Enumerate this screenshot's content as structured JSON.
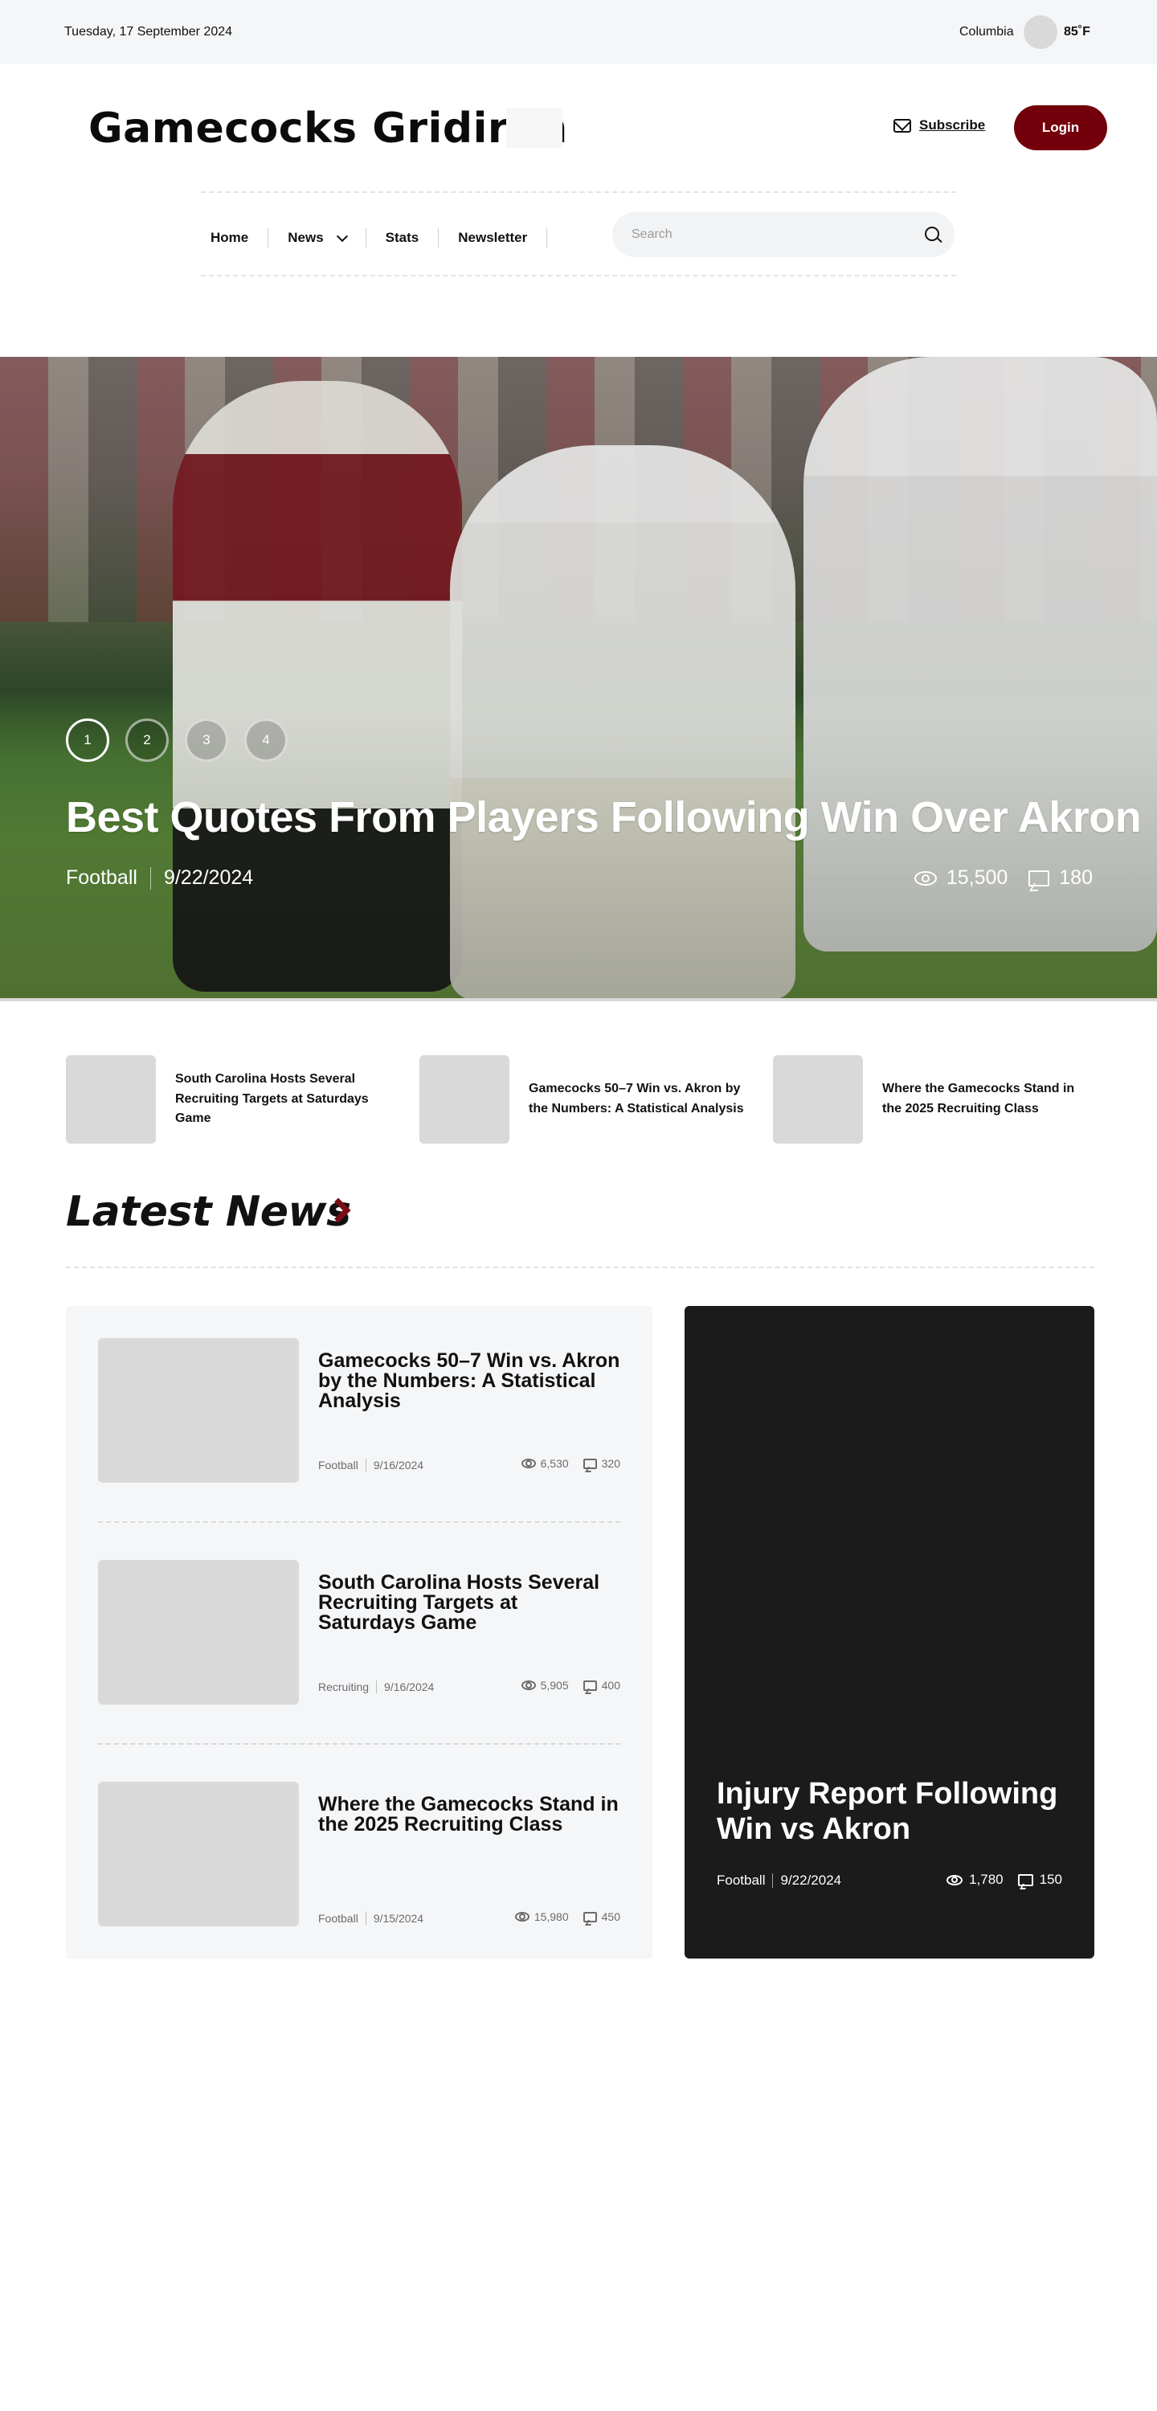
{
  "topbar": {
    "date": "Tuesday, 17 September 2024",
    "location": "Columbia",
    "temperature": "85˚F",
    "weather_icon": "weather-icon"
  },
  "header": {
    "logo": "Gamecocks Gridiron",
    "subscribe_label": "Subscribe",
    "subscribe_icon": "mail-icon",
    "login_label": "Login",
    "accent_color": "#73000a"
  },
  "nav": {
    "items": [
      {
        "label": "Home",
        "has_dropdown": false
      },
      {
        "label": "News",
        "has_dropdown": true
      },
      {
        "label": "Stats",
        "has_dropdown": false
      },
      {
        "label": "Newsletter",
        "has_dropdown": false
      }
    ],
    "search_placeholder": "Search",
    "search_icon": "search-icon"
  },
  "hero": {
    "slides": [
      "1",
      "2",
      "3",
      "4"
    ],
    "active_slide": "1",
    "title": "Best Quotes From Players Following Win Over Akron",
    "category": "Football",
    "date": "9/22/2024",
    "views": "15,500",
    "comments": "180"
  },
  "mini_stories": [
    {
      "title": "South Carolina Hosts Several Recruiting Targets at Saturdays Game"
    },
    {
      "title": "Gamecocks 50–7 Win vs. Akron by the Numbers: A Statistical Analysis"
    },
    {
      "title": "Where the Gamecocks Stand in the 2025 Recruiting Class"
    }
  ],
  "latest": {
    "heading": "Latest News",
    "items": [
      {
        "title": "Gamecocks 50–7 Win vs. Akron by the Numbers: A Statistical Analysis",
        "category": "Football",
        "date": "9/16/2024",
        "views": "6,530",
        "comments": "320"
      },
      {
        "title": "South Carolina Hosts Several Recruiting Targets at Saturdays Game",
        "category": "Recruiting",
        "date": "9/16/2024",
        "views": "5,905",
        "comments": "400"
      },
      {
        "title": "Where the Gamecocks Stand in the 2025 Recruiting Class",
        "category": "Football",
        "date": "9/15/2024",
        "views": "15,980",
        "comments": "450"
      }
    ],
    "feature": {
      "title": "Injury Report Following Win vs Akron",
      "category": "Football",
      "date": "9/22/2024",
      "views": "1,780",
      "comments": "150"
    }
  }
}
